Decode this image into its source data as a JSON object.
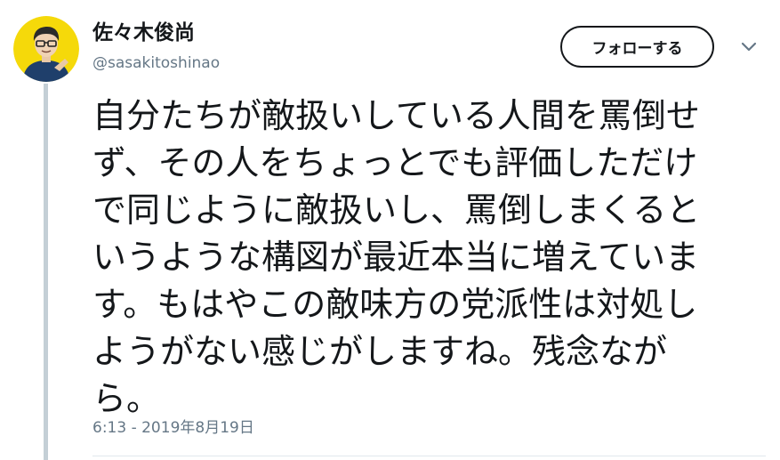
{
  "user": {
    "display_name": "佐々木俊尚",
    "handle": "@sasakitoshinao",
    "avatar_icon": "user-avatar-icon"
  },
  "actions": {
    "follow_label": "フォロー",
    "follow_suffix": "する",
    "menu_icon": "chevron-down-icon"
  },
  "tweet": {
    "lines": [
      "自分たちが敵扱いしている人間を罵倒せ",
      "ず、その人をちょっとでも評価しただけ",
      "で同じように敵扱いし、罵倒しまくると",
      "いうような構図が最近本当に増えていま",
      "す。もはやこの敵味方の党派性は対処し",
      "ようがない感じがしますね。残念なが",
      "ら。"
    ],
    "timestamp": "6:13 - 2019年8月19日"
  },
  "colors": {
    "text": "#14171a",
    "secondary": "#657786",
    "thread_line": "#c4cfd6",
    "avatar_bg": "#f5d90a"
  }
}
